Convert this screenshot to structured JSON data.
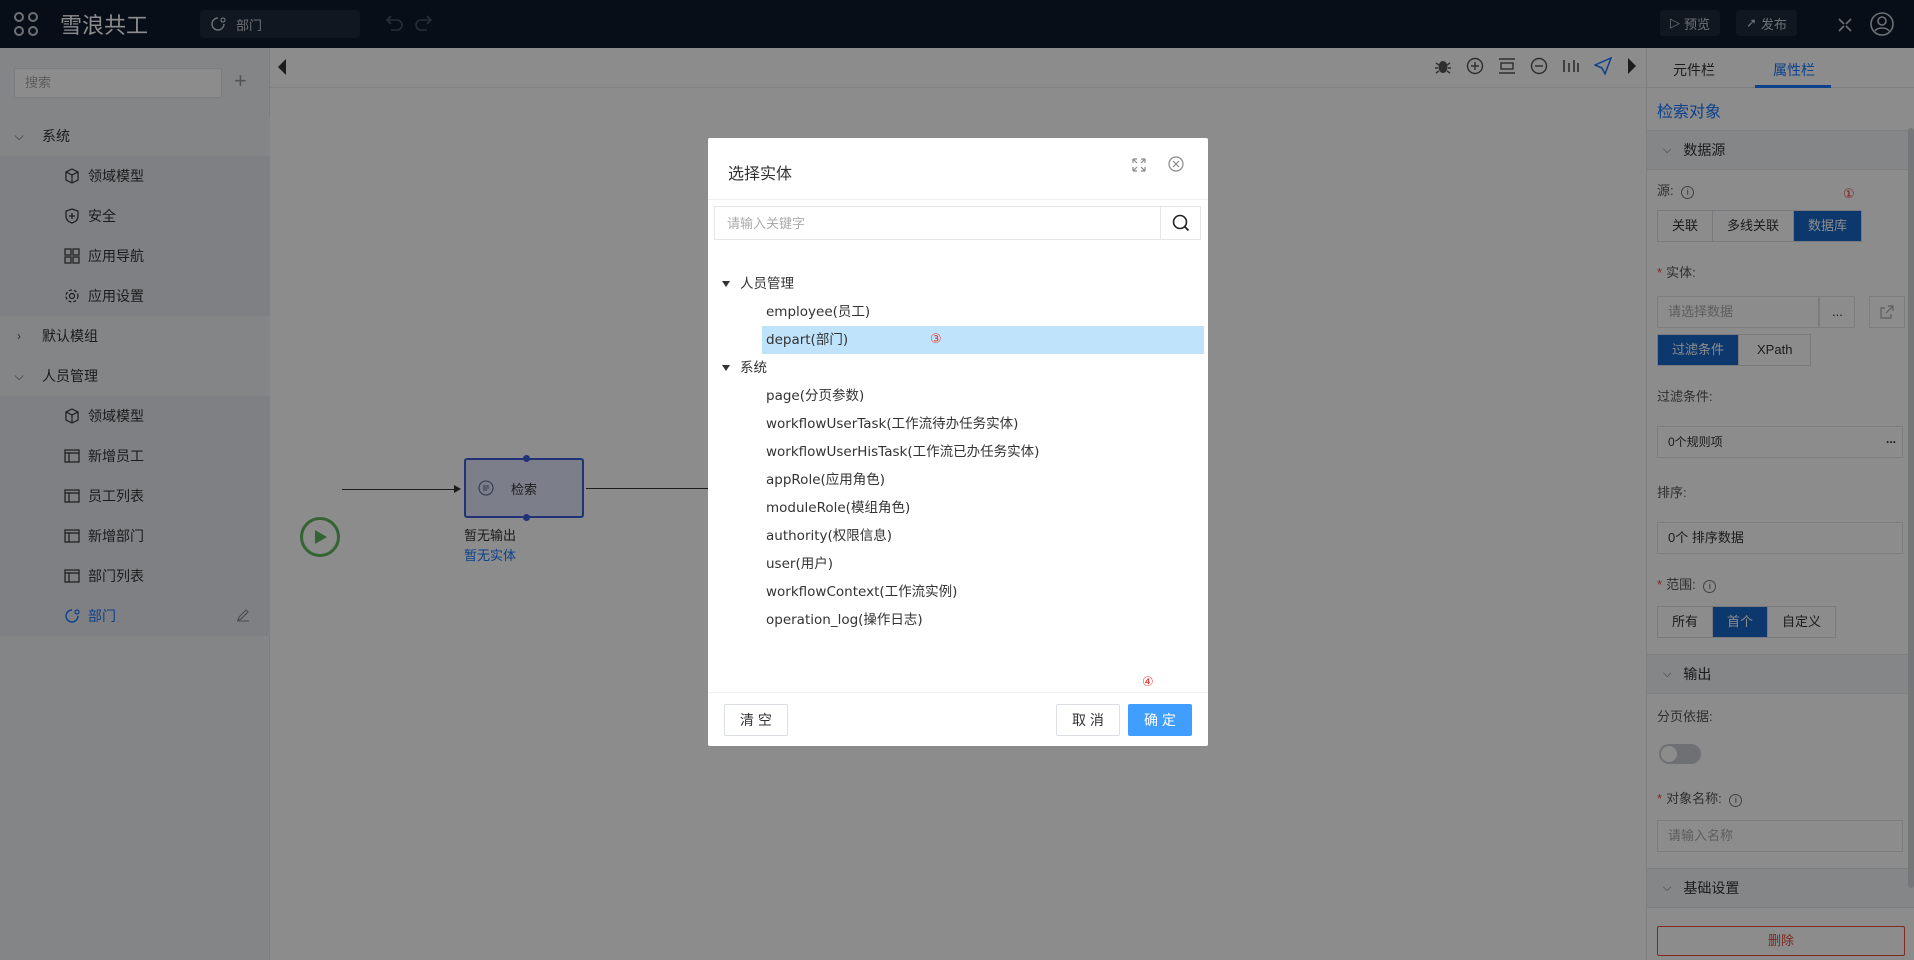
{
  "app": {
    "title": "雪浪共工",
    "current_page": "部门"
  },
  "topbar": {
    "preview_label": "预览",
    "publish_label": "发布"
  },
  "sidebar": {
    "search_placeholder": "搜索",
    "add_symbol": "+",
    "items": [
      {
        "label": "系统",
        "kind": "group",
        "expanded": true
      },
      {
        "label": "领域模型",
        "kind": "child",
        "icon": "cube-icon"
      },
      {
        "label": "安全",
        "kind": "child",
        "icon": "shield-icon"
      },
      {
        "label": "应用导航",
        "kind": "child",
        "icon": "grid-icon"
      },
      {
        "label": "应用设置",
        "kind": "child",
        "icon": "gear-icon"
      },
      {
        "label": "默认模组",
        "kind": "group",
        "expanded": false
      },
      {
        "label": "人员管理",
        "kind": "group",
        "expanded": true
      },
      {
        "label": "领域模型",
        "kind": "child",
        "icon": "cube-icon"
      },
      {
        "label": "新增员工",
        "kind": "child",
        "icon": "page-icon"
      },
      {
        "label": "员工列表",
        "kind": "child",
        "icon": "page-icon"
      },
      {
        "label": "新增部门",
        "kind": "child",
        "icon": "page-icon"
      },
      {
        "label": "部门列表",
        "kind": "child",
        "icon": "page-icon"
      },
      {
        "label": "部门",
        "kind": "child",
        "icon": "flow-icon",
        "active": true
      }
    ]
  },
  "canvas": {
    "node_label": "检索",
    "node_output": "暂无输出",
    "node_entity": "暂无实体"
  },
  "right_panel": {
    "tabs": [
      "元件栏",
      "属性栏"
    ],
    "active_tab": "属性栏",
    "title": "检索对象",
    "datasource_section": "数据源",
    "source_label": "源:",
    "source_options": [
      "关联",
      "多线关联",
      "数据库"
    ],
    "source_selected": "数据库",
    "annotation_1": "①",
    "entity_label": "实体:",
    "entity_placeholder": "请选择数据",
    "entity_more": "...",
    "filter_tabs": [
      "过滤条件",
      "XPath"
    ],
    "filter_label": "过滤条件:",
    "filter_value": "0个规则项",
    "filter_more": "...",
    "sort_label": "排序:",
    "sort_value": "0个 排序数据",
    "range_label": "范围:",
    "range_options": [
      "所有",
      "首个",
      "自定义"
    ],
    "range_selected": "首个",
    "output_section": "输出",
    "paging_label": "分页依据:",
    "object_name_label": "对象名称:",
    "object_name_placeholder": "请输入名称",
    "basic_section": "基础设置",
    "delete_label": "删除"
  },
  "modal": {
    "title": "选择实体",
    "search_placeholder": "请输入关键字",
    "groups": [
      {
        "label": "人员管理",
        "items": [
          "employee(员工)",
          "depart(部门)"
        ]
      },
      {
        "label": "系统",
        "items": [
          "page(分页参数)",
          "workflowUserTask(工作流待办任务实体)",
          "workflowUserHisTask(工作流已办任务实体)",
          "appRole(应用角色)",
          "moduleRole(模组角色)",
          "authority(权限信息)",
          "user(用户)",
          "workflowContext(工作流实例)",
          "operation_log(操作日志)"
        ]
      }
    ],
    "selected_item": "depart(部门)",
    "annotation_3": "③",
    "annotation_4": "④",
    "clear_label": "清 空",
    "cancel_label": "取 消",
    "ok_label": "确 定"
  },
  "colors": {
    "topbar": "#0f1a2c",
    "accent": "#1677ff",
    "selected_seg": "#1766c7",
    "primary_button": "#409eff",
    "tree_selected": "#bfe3fb",
    "annotation": "#e53935"
  }
}
